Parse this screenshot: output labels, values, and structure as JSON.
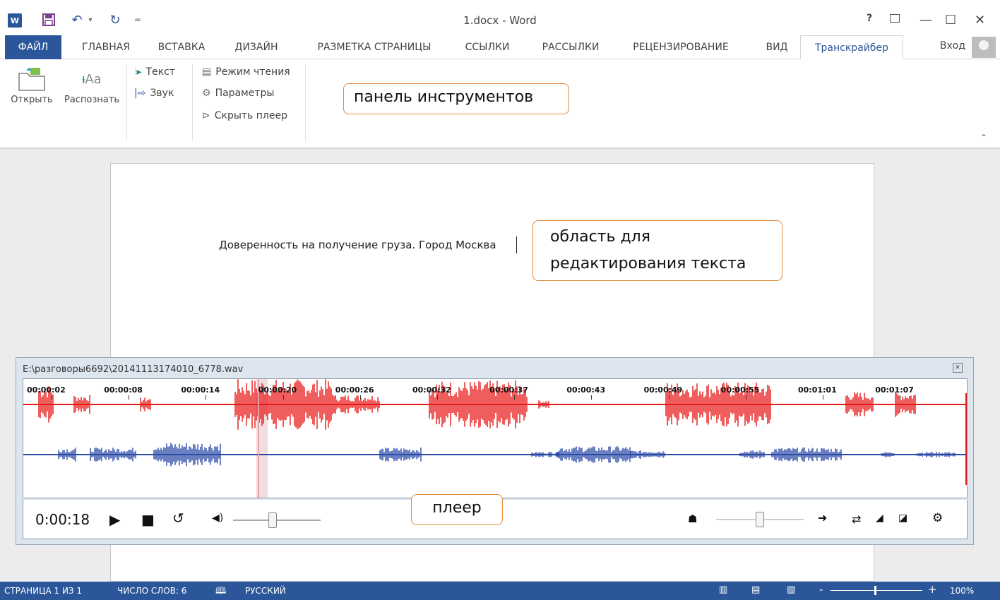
{
  "window": {
    "title": "1.docx - Word",
    "help": "?",
    "minimize": "—",
    "maximize": "☐",
    "close": "✕"
  },
  "qat": {
    "word_logo": "W",
    "save_icon": "save-icon",
    "undo": "↶",
    "redo": "↻",
    "customize": "="
  },
  "tabs": {
    "file": "ФАЙЛ",
    "home": "ГЛАВНАЯ",
    "insert": "ВСТАВКА",
    "design": "ДИЗАЙН",
    "layout": "РАЗМЕТКА СТРАНИЦЫ",
    "references": "ССЫЛКИ",
    "mailings": "РАССЫЛКИ",
    "review": "РЕЦЕНЗИРОВАНИЕ",
    "view": "ВИД",
    "transcriber": "Транскрайбер",
    "login": "Вход"
  },
  "ribbon": {
    "open": "Открыть",
    "recognize": "Распознать",
    "text": "Текст",
    "sound": "Звук",
    "reading_mode": "Режим чтения",
    "parameters": "Параметры",
    "hide_player": "Скрыть плеер"
  },
  "callouts": {
    "toolbar": "панель инструментов",
    "edit_line1": "область для",
    "edit_line2": "редактирования текста",
    "player": "плеер"
  },
  "document": {
    "text": "Доверенность на получение груза. Город Москва"
  },
  "player": {
    "file_path": "E:\\разговоры6692\\20141113174010_6778.wav",
    "current_time": "0:00:18",
    "volume_level": 0.45,
    "speed_level": 0.5,
    "ruler": [
      "00:00:02",
      "00:00:08",
      "00:00:14",
      "00:00:20",
      "00:00:26",
      "00:00:32",
      "00:00:37",
      "00:00:43",
      "00:00:49",
      "00:00:55",
      "00:01:01",
      "00:01:07"
    ],
    "colors": {
      "channel1": "#e81818",
      "channel2": "#2a4aa6",
      "playhead": "#e8a0a8"
    }
  },
  "statusbar": {
    "page": "СТРАНИЦА 1 ИЗ 1",
    "words": "ЧИСЛО СЛОВ: 6",
    "language": "РУССКИЙ",
    "zoom_minus": "-",
    "zoom_plus": "+",
    "zoom": "100%"
  }
}
